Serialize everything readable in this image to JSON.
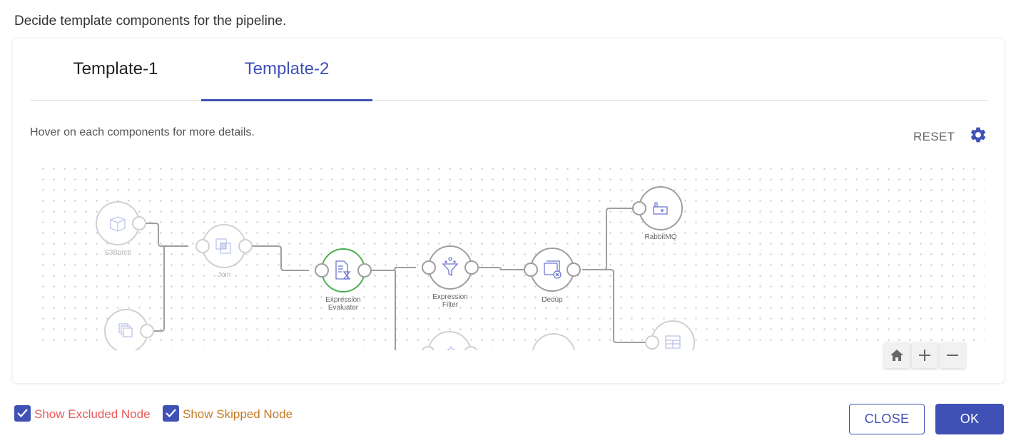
{
  "intro_text": "Decide template components for the pipeline.",
  "tabs": [
    {
      "label": "Template-1",
      "active": false
    },
    {
      "label": "Template-2",
      "active": true
    }
  ],
  "canvas": {
    "hint": "Hover on each components for more details.",
    "reset_label": "RESET",
    "settings_icon": "gear-icon",
    "zoom_controls": [
      {
        "name": "home",
        "icon": "home-icon"
      },
      {
        "name": "zoom-in",
        "icon": "plus-icon"
      },
      {
        "name": "zoom-out",
        "icon": "minus-icon"
      }
    ],
    "nodes": [
      {
        "id": "s3batch",
        "label": "S3Batch",
        "icon": "cube-icon",
        "state": "excluded"
      },
      {
        "id": "source2",
        "label": "",
        "icon": "stacked-files-icon",
        "state": "excluded"
      },
      {
        "id": "join",
        "label": "Join",
        "icon": "join-icon",
        "state": "excluded"
      },
      {
        "id": "expr-eval",
        "label": "Expression Evaluator",
        "icon": "document-hourglass-icon",
        "state": "selected"
      },
      {
        "id": "expr-filter",
        "label": "Expression Filter",
        "icon": "funnel-icon",
        "state": "normal"
      },
      {
        "id": "dedup",
        "label": "Dedup",
        "icon": "window-close-icon",
        "state": "normal"
      },
      {
        "id": "rabbitmq",
        "label": "RabbitMQ",
        "icon": "rabbitmq-icon",
        "state": "normal"
      },
      {
        "id": "table-sink",
        "label": "",
        "icon": "table-icon",
        "state": "excluded"
      },
      {
        "id": "lower-a",
        "label": "",
        "icon": "sparkle-icon",
        "state": "excluded"
      },
      {
        "id": "lower-b",
        "label": "",
        "icon": "",
        "state": "excluded"
      }
    ]
  },
  "footer": {
    "show_excluded": {
      "label": "Show Excluded Node",
      "checked": true,
      "color": "#e85a5a"
    },
    "show_skipped": {
      "label": "Show Skipped Node",
      "checked": true,
      "color": "#c27a25"
    },
    "close_label": "CLOSE",
    "ok_label": "OK"
  },
  "colors": {
    "accent": "#3f51b5",
    "selected_node": "#4caf50",
    "node_border": "#a8a8a8",
    "faded_border": "#d0d0d0"
  }
}
